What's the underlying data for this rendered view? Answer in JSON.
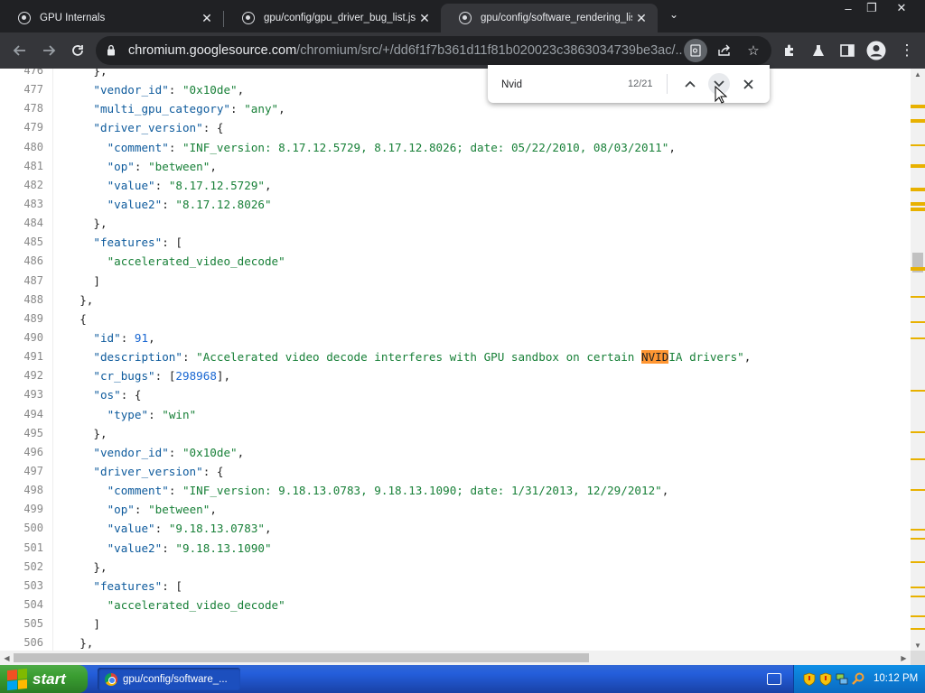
{
  "browser": {
    "tabs": [
      {
        "title": "GPU Internals",
        "active": false
      },
      {
        "title": "gpu/config/gpu_driver_bug_list.json",
        "active": false
      },
      {
        "title": "gpu/config/software_rendering_list",
        "active": true
      }
    ],
    "window_controls": {
      "minimize": "–",
      "restore": "❐",
      "close": "✕"
    },
    "url_host": "chromium.googlesource.com",
    "url_path": "/chromium/src/+/dd6f1f7b361d11f81b020023c3863034739be3ac/..."
  },
  "find_bar": {
    "query": "Nvid",
    "count": "12/21"
  },
  "code": {
    "highlight": "NVID",
    "lines": [
      {
        "n": "476",
        "t": "    },"
      },
      {
        "n": "477",
        "t": "    \"vendor_id\": \"0x10de\","
      },
      {
        "n": "478",
        "t": "    \"multi_gpu_category\": \"any\","
      },
      {
        "n": "479",
        "t": "    \"driver_version\": {"
      },
      {
        "n": "480",
        "t": "      \"comment\": \"INF_version: 8.17.12.5729, 8.17.12.8026; date: 05/22/2010, 08/03/2011\","
      },
      {
        "n": "481",
        "t": "      \"op\": \"between\","
      },
      {
        "n": "482",
        "t": "      \"value\": \"8.17.12.5729\","
      },
      {
        "n": "483",
        "t": "      \"value2\": \"8.17.12.8026\""
      },
      {
        "n": "484",
        "t": "    },"
      },
      {
        "n": "485",
        "t": "    \"features\": ["
      },
      {
        "n": "486",
        "t": "      \"accelerated_video_decode\""
      },
      {
        "n": "487",
        "t": "    ]"
      },
      {
        "n": "488",
        "t": "  },"
      },
      {
        "n": "489",
        "t": "  {"
      },
      {
        "n": "490",
        "t": "    \"id\": 91,"
      },
      {
        "n": "491",
        "t": "    \"description\": \"Accelerated video decode interferes with GPU sandbox on certain NVIDIA drivers\","
      },
      {
        "n": "492",
        "t": "    \"cr_bugs\": [298968],"
      },
      {
        "n": "493",
        "t": "    \"os\": {"
      },
      {
        "n": "494",
        "t": "      \"type\": \"win\""
      },
      {
        "n": "495",
        "t": "    },"
      },
      {
        "n": "496",
        "t": "    \"vendor_id\": \"0x10de\","
      },
      {
        "n": "497",
        "t": "    \"driver_version\": {"
      },
      {
        "n": "498",
        "t": "      \"comment\": \"INF_version: 9.18.13.0783, 9.18.13.1090; date: 1/31/2013, 12/29/2012\","
      },
      {
        "n": "499",
        "t": "      \"op\": \"between\","
      },
      {
        "n": "500",
        "t": "      \"value\": \"9.18.13.0783\","
      },
      {
        "n": "501",
        "t": "      \"value2\": \"9.18.13.1090\""
      },
      {
        "n": "502",
        "t": "    },"
      },
      {
        "n": "503",
        "t": "    \"features\": ["
      },
      {
        "n": "504",
        "t": "      \"accelerated_video_decode\""
      },
      {
        "n": "505",
        "t": "    ]"
      },
      {
        "n": "506",
        "t": "  },"
      }
    ]
  },
  "taskbar": {
    "start_label": "start",
    "task_label": "gpu/config/software_...",
    "clock": "10:12 PM"
  },
  "colors": {
    "json_key": "#0d5a9c",
    "json_string": "#188038",
    "json_number": "#1967d2",
    "find_highlight": "#ff9632",
    "scroll_marker": "#e8b100"
  }
}
